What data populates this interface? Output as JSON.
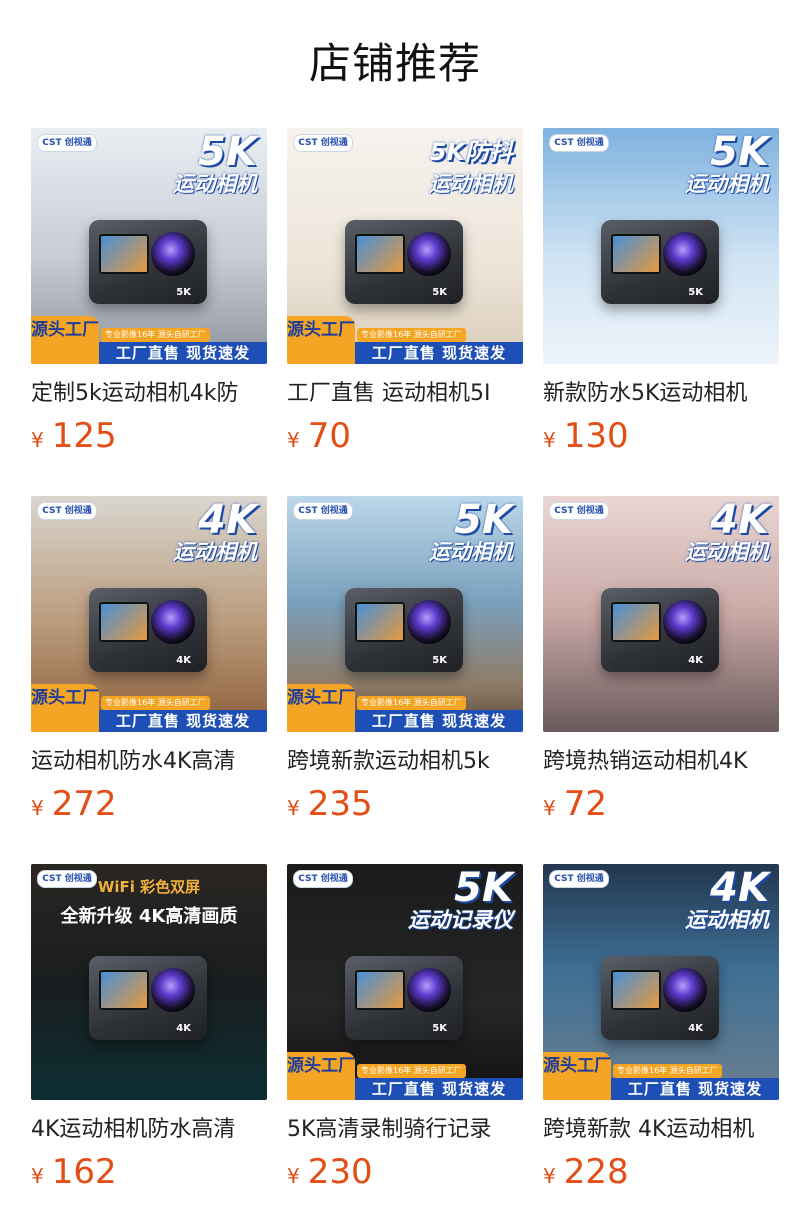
{
  "section_title": "店铺推荐",
  "brand_label": "CST 创视通",
  "promo": {
    "source": "源头工厂",
    "tagline": "专业影像16年 源头自研工厂",
    "bar": "工厂直售 现货速发"
  },
  "currency": "¥",
  "products": [
    {
      "name": "定制5k运动相机4k防",
      "price": "125",
      "headline": "5K",
      "subline": "运动相机",
      "theme": "gray",
      "promo": true
    },
    {
      "name": "工厂直售 运动相机5I",
      "price": "70",
      "headline": "5K防抖",
      "subline": "运动相机",
      "theme": "orange",
      "promo": true
    },
    {
      "name": "新款防水5K运动相机",
      "price": "130",
      "headline": "5K",
      "subline": "运动相机",
      "theme": "snow",
      "promo": false
    },
    {
      "name": "运动相机防水4K高清",
      "price": "272",
      "headline": "4K",
      "subline": "运动相机",
      "theme": "desert",
      "promo": true
    },
    {
      "name": "跨境新款运动相机5k",
      "price": "235",
      "headline": "5K",
      "subline": "运动相机",
      "theme": "beach",
      "promo": true
    },
    {
      "name": "跨境热销运动相机4K",
      "price": "72",
      "headline": "4K",
      "subline": "运动相机",
      "theme": "rose",
      "promo": false
    },
    {
      "name": "4K运动相机防水高清",
      "price": "162",
      "headline": "WiFi 彩色双屏",
      "subline": "全新升级 4K高清画质",
      "theme": "dark",
      "promo": false
    },
    {
      "name": "5K高清录制骑行记录",
      "price": "230",
      "headline": "5K",
      "subline": "运动记录仪",
      "theme": "black",
      "promo": true
    },
    {
      "name": "跨境新款 4K运动相机",
      "price": "228",
      "headline": "4K",
      "subline": "运动相机",
      "theme": "sky",
      "promo": true
    }
  ]
}
